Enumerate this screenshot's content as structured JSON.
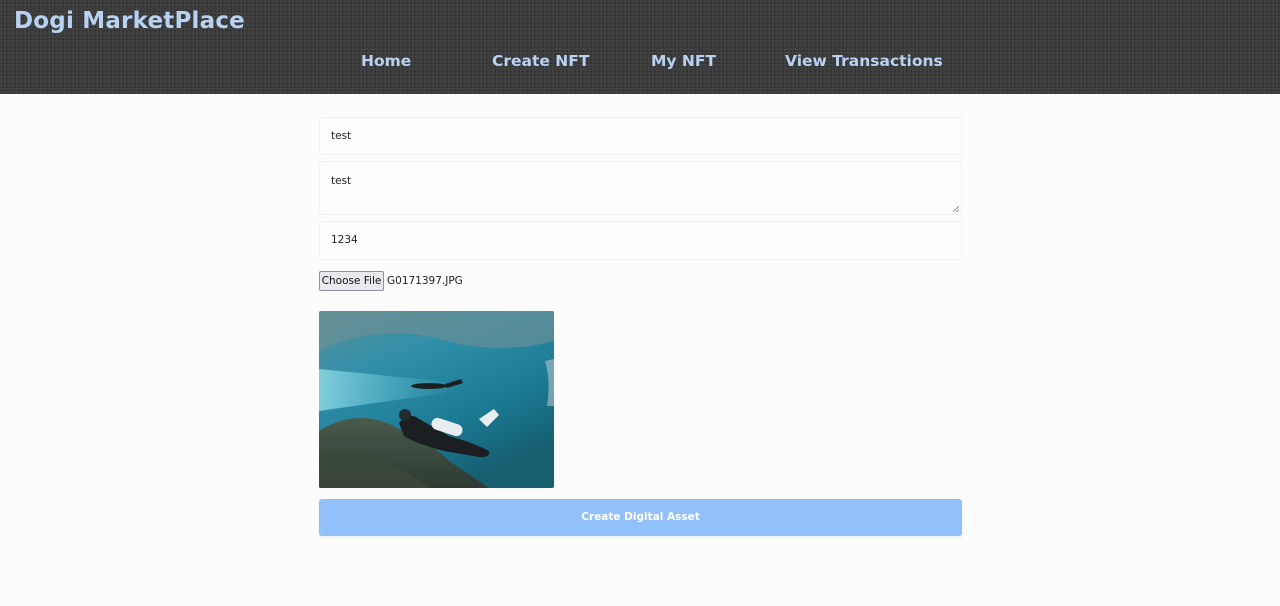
{
  "header": {
    "brand": "Dogi MarketPlace",
    "nav": [
      {
        "label": "Home"
      },
      {
        "label": "Create NFT"
      },
      {
        "label": "My NFT"
      },
      {
        "label": "View Transactions"
      }
    ]
  },
  "form": {
    "name_value": "test",
    "description_value": "test",
    "price_value": "1234",
    "file_button_label": "Choose File",
    "file_name": "G0171397.JPG",
    "submit_label": "Create Digital Asset"
  },
  "colors": {
    "header_bg": "#3b3b3b",
    "nav_text": "#b8d2f3",
    "submit_bg": "#92c0f8"
  }
}
